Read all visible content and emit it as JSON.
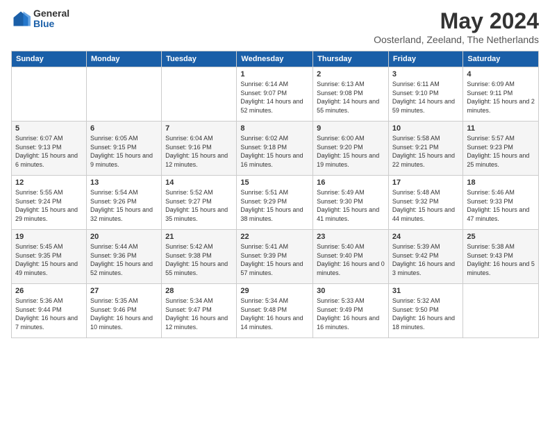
{
  "logo": {
    "general": "General",
    "blue": "Blue"
  },
  "header": {
    "title": "May 2024",
    "subtitle": "Oosterland, Zeeland, The Netherlands"
  },
  "weekdays": [
    "Sunday",
    "Monday",
    "Tuesday",
    "Wednesday",
    "Thursday",
    "Friday",
    "Saturday"
  ],
  "weeks": [
    [
      {
        "day": "",
        "info": ""
      },
      {
        "day": "",
        "info": ""
      },
      {
        "day": "",
        "info": ""
      },
      {
        "day": "1",
        "info": "Sunrise: 6:14 AM\nSunset: 9:07 PM\nDaylight: 14 hours and 52 minutes."
      },
      {
        "day": "2",
        "info": "Sunrise: 6:13 AM\nSunset: 9:08 PM\nDaylight: 14 hours and 55 minutes."
      },
      {
        "day": "3",
        "info": "Sunrise: 6:11 AM\nSunset: 9:10 PM\nDaylight: 14 hours and 59 minutes."
      },
      {
        "day": "4",
        "info": "Sunrise: 6:09 AM\nSunset: 9:11 PM\nDaylight: 15 hours and 2 minutes."
      }
    ],
    [
      {
        "day": "5",
        "info": "Sunrise: 6:07 AM\nSunset: 9:13 PM\nDaylight: 15 hours and 6 minutes."
      },
      {
        "day": "6",
        "info": "Sunrise: 6:05 AM\nSunset: 9:15 PM\nDaylight: 15 hours and 9 minutes."
      },
      {
        "day": "7",
        "info": "Sunrise: 6:04 AM\nSunset: 9:16 PM\nDaylight: 15 hours and 12 minutes."
      },
      {
        "day": "8",
        "info": "Sunrise: 6:02 AM\nSunset: 9:18 PM\nDaylight: 15 hours and 16 minutes."
      },
      {
        "day": "9",
        "info": "Sunrise: 6:00 AM\nSunset: 9:20 PM\nDaylight: 15 hours and 19 minutes."
      },
      {
        "day": "10",
        "info": "Sunrise: 5:58 AM\nSunset: 9:21 PM\nDaylight: 15 hours and 22 minutes."
      },
      {
        "day": "11",
        "info": "Sunrise: 5:57 AM\nSunset: 9:23 PM\nDaylight: 15 hours and 25 minutes."
      }
    ],
    [
      {
        "day": "12",
        "info": "Sunrise: 5:55 AM\nSunset: 9:24 PM\nDaylight: 15 hours and 29 minutes."
      },
      {
        "day": "13",
        "info": "Sunrise: 5:54 AM\nSunset: 9:26 PM\nDaylight: 15 hours and 32 minutes."
      },
      {
        "day": "14",
        "info": "Sunrise: 5:52 AM\nSunset: 9:27 PM\nDaylight: 15 hours and 35 minutes."
      },
      {
        "day": "15",
        "info": "Sunrise: 5:51 AM\nSunset: 9:29 PM\nDaylight: 15 hours and 38 minutes."
      },
      {
        "day": "16",
        "info": "Sunrise: 5:49 AM\nSunset: 9:30 PM\nDaylight: 15 hours and 41 minutes."
      },
      {
        "day": "17",
        "info": "Sunrise: 5:48 AM\nSunset: 9:32 PM\nDaylight: 15 hours and 44 minutes."
      },
      {
        "day": "18",
        "info": "Sunrise: 5:46 AM\nSunset: 9:33 PM\nDaylight: 15 hours and 47 minutes."
      }
    ],
    [
      {
        "day": "19",
        "info": "Sunrise: 5:45 AM\nSunset: 9:35 PM\nDaylight: 15 hours and 49 minutes."
      },
      {
        "day": "20",
        "info": "Sunrise: 5:44 AM\nSunset: 9:36 PM\nDaylight: 15 hours and 52 minutes."
      },
      {
        "day": "21",
        "info": "Sunrise: 5:42 AM\nSunset: 9:38 PM\nDaylight: 15 hours and 55 minutes."
      },
      {
        "day": "22",
        "info": "Sunrise: 5:41 AM\nSunset: 9:39 PM\nDaylight: 15 hours and 57 minutes."
      },
      {
        "day": "23",
        "info": "Sunrise: 5:40 AM\nSunset: 9:40 PM\nDaylight: 16 hours and 0 minutes."
      },
      {
        "day": "24",
        "info": "Sunrise: 5:39 AM\nSunset: 9:42 PM\nDaylight: 16 hours and 3 minutes."
      },
      {
        "day": "25",
        "info": "Sunrise: 5:38 AM\nSunset: 9:43 PM\nDaylight: 16 hours and 5 minutes."
      }
    ],
    [
      {
        "day": "26",
        "info": "Sunrise: 5:36 AM\nSunset: 9:44 PM\nDaylight: 16 hours and 7 minutes."
      },
      {
        "day": "27",
        "info": "Sunrise: 5:35 AM\nSunset: 9:46 PM\nDaylight: 16 hours and 10 minutes."
      },
      {
        "day": "28",
        "info": "Sunrise: 5:34 AM\nSunset: 9:47 PM\nDaylight: 16 hours and 12 minutes."
      },
      {
        "day": "29",
        "info": "Sunrise: 5:34 AM\nSunset: 9:48 PM\nDaylight: 16 hours and 14 minutes."
      },
      {
        "day": "30",
        "info": "Sunrise: 5:33 AM\nSunset: 9:49 PM\nDaylight: 16 hours and 16 minutes."
      },
      {
        "day": "31",
        "info": "Sunrise: 5:32 AM\nSunset: 9:50 PM\nDaylight: 16 hours and 18 minutes."
      },
      {
        "day": "",
        "info": ""
      }
    ]
  ]
}
